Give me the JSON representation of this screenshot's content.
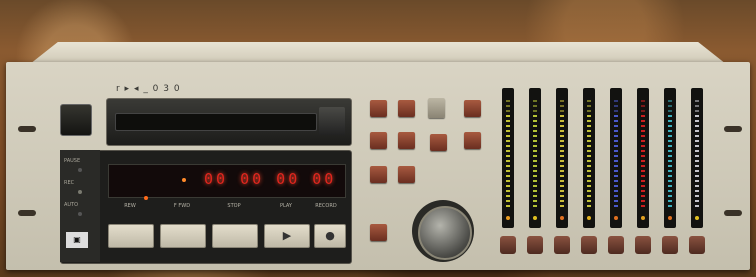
{
  "device": {
    "model_label": "r ▸ ◂ _ 0 3 0",
    "time_display": "00 00 00 00"
  },
  "status_leds": [
    {
      "label": "PAUSE"
    },
    {
      "label": "REC"
    },
    {
      "label": "AUTO"
    }
  ],
  "transport": [
    {
      "label": "REW",
      "glyph": ""
    },
    {
      "label": "F FWD",
      "glyph": ""
    },
    {
      "label": "STOP",
      "glyph": ""
    },
    {
      "label": "PLAY",
      "glyph": "▶"
    },
    {
      "label": "RECORD",
      "glyph": "●"
    }
  ],
  "meters": [
    {
      "color": "#d8d838",
      "peak": "#e89a20"
    },
    {
      "color": "#c8d83a",
      "peak": "#e0c020"
    },
    {
      "color": "#e0d040",
      "peak": "#e07020"
    },
    {
      "color": "#d8d840",
      "peak": "#e0b020"
    },
    {
      "color": "#5060e0",
      "peak": "#e07020"
    },
    {
      "color": "#e02020",
      "peak": "#e0a020"
    },
    {
      "color": "#40c0d0",
      "peak": "#e07020"
    },
    {
      "color": "#d8d8e0",
      "peak": "#e0c020"
    }
  ]
}
